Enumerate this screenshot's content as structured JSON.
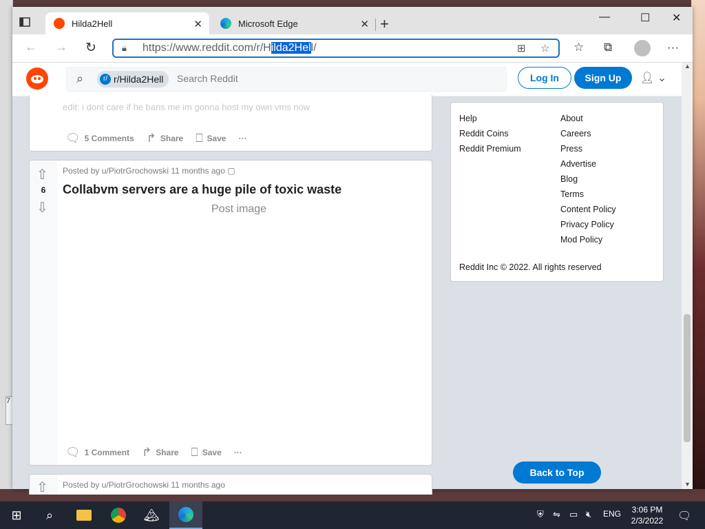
{
  "browser": {
    "tabs": [
      {
        "label": "Hilda2Hell",
        "active": true,
        "icon": "reddit-favicon"
      },
      {
        "label": "Microsoft Edge",
        "active": false,
        "icon": "edge-favicon"
      }
    ],
    "address": {
      "prefix": "https://www.reddit.com/r/H",
      "selected": "ilda2Hel",
      "suffix": "l/"
    },
    "window_controls": {
      "minimize": "—",
      "maximize": "☐",
      "close": "✕"
    }
  },
  "reddit": {
    "subreddit_chip": "r/Hilda2Hell",
    "search_placeholder": "Search Reddit",
    "login_label": "Log In",
    "signup_label": "Sign Up",
    "accent": "#0079d3",
    "brand": "#ff4500"
  },
  "posts": [
    {
      "text_snippet": "edit: i dont care if he bans me im gonna host my own vms now",
      "actions": {
        "comments": "5 Comments",
        "share": "Share",
        "save": "Save"
      }
    },
    {
      "meta": "Posted by u/PiotrGrochowski 11 months ago",
      "score": "6",
      "title": "Collabvm servers are a huge pile of toxic waste",
      "image_alt": "Post image",
      "actions": {
        "comments": "1 Comment",
        "share": "Share",
        "save": "Save"
      }
    },
    {
      "meta": "Posted by u/PiotrGrochowski 11 months ago"
    }
  ],
  "sidebar": {
    "col1": [
      "Help",
      "Reddit Coins",
      "Reddit Premium"
    ],
    "col2": [
      "About",
      "Careers",
      "Press",
      "Advertise",
      "Blog",
      "Terms",
      "Content Policy",
      "Privacy Policy",
      "Mod Policy"
    ],
    "copyright": "Reddit Inc © 2022. All rights reserved",
    "back_to_top": "Back to Top"
  },
  "taskbar": {
    "lang": "ENG",
    "time": "3:06 PM",
    "date": "2/3/2022"
  }
}
